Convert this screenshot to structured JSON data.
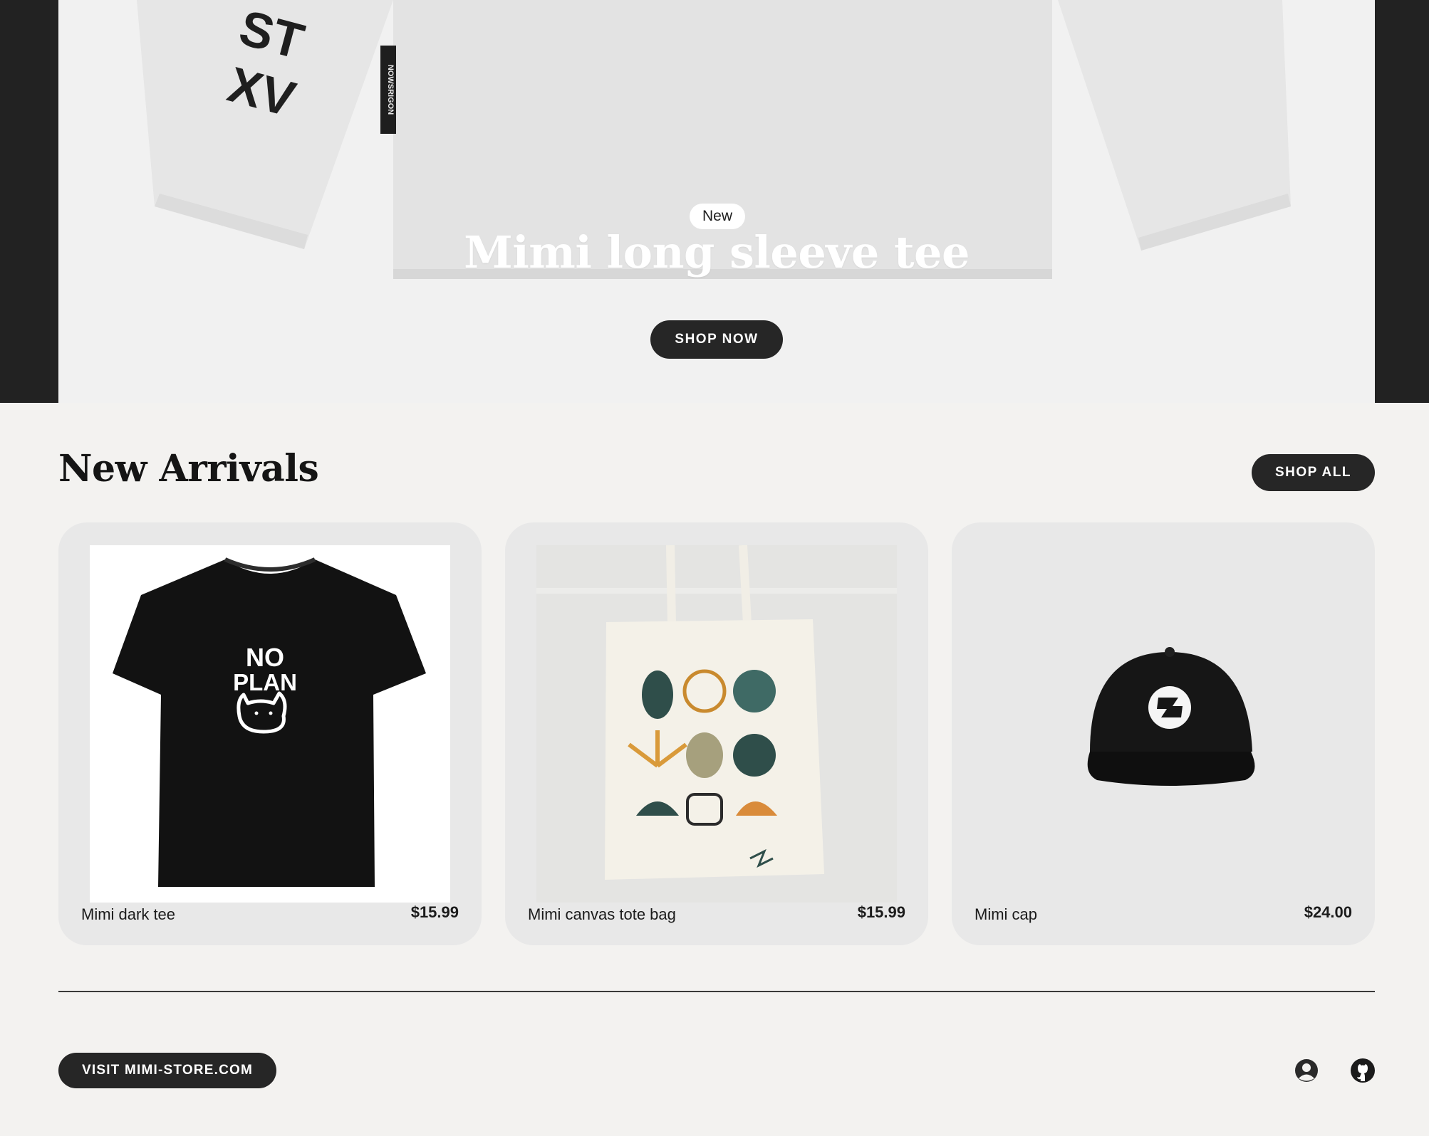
{
  "hero": {
    "badge": "New",
    "title": "Mimi long sleeve tee",
    "cta_label": "SHOP NOW",
    "sleeve_print": [
      "ST",
      "XV"
    ],
    "neck_label": "NOWSRIGON"
  },
  "new_arrivals": {
    "title": "New Arrivals",
    "shop_all_label": "SHOP ALL",
    "products": [
      {
        "name": "Mimi dark tee",
        "price": "$15.99",
        "print_lines": [
          "NO",
          "PLAN"
        ]
      },
      {
        "name": "Mimi canvas tote bag",
        "price": "$15.99"
      },
      {
        "name": "Mimi cap",
        "price": "$24.00"
      }
    ]
  },
  "footer": {
    "visit_label": "VISIT MIMI-STORE.COM",
    "icons": [
      "account-icon",
      "github-icon"
    ]
  },
  "colors": {
    "page_background": "#f3f2f0",
    "hero_frame": "#222222",
    "button_background": "#262626",
    "card_background": "#e8e8e8"
  }
}
